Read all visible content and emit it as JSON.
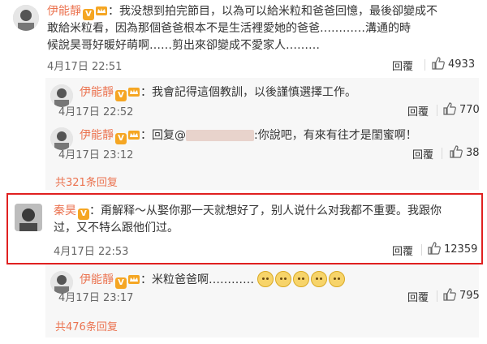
{
  "comments": [
    {
      "name": "伊能靜",
      "text_line1": "：我没想到拍完節目，以為可以給米粒和爸爸回憶，最後卻變成不",
      "text_line2": "敢給米粒看，因為那個爸爸根本不是生活裡愛她的爸爸…………溝通的時",
      "text_line3": "候說昊哥好暖好萌啊……剪出來卻變成不愛家人………",
      "time": "4月17日 22:51",
      "reply": "回覆",
      "likes": "4933"
    },
    {
      "name": "秦昊",
      "text_line1": "：甭解释～从娶你那一天就想好了，别人说什么对我都不重要。我跟你",
      "text_line2": "过，又不特么跟他们过。",
      "time": "4月17日 22:53",
      "reply": "回覆",
      "likes": "12359"
    }
  ],
  "replies_top": [
    {
      "name": "伊能靜",
      "text": "：我會記得這個教訓，以後謹慎選擇工作。",
      "time": "4月17日 22:52",
      "reply": "回覆",
      "likes": "770"
    },
    {
      "name": "伊能靜",
      "text_prefix": "：回复@",
      "text_suffix": ":你說吧，有來有往才是閨蜜啊！",
      "time": "4月17日 23:12",
      "reply": "回覆",
      "likes": "38"
    }
  ],
  "more_top": "共321条回复",
  "reply_bottom": {
    "name": "伊能靜",
    "text": "：米粒爸爸啊…………",
    "time": "4月17日 23:17",
    "reply": "回覆",
    "likes": "795"
  },
  "more_bottom": "共476条回复",
  "colors": {
    "name": "#eb7350",
    "highlight": "#e02020",
    "reply_bg": "#f7f7f7"
  },
  "icons": [
    "thumb-up-icon",
    "verified-v-icon",
    "crown-icon",
    "emoji-icon"
  ]
}
